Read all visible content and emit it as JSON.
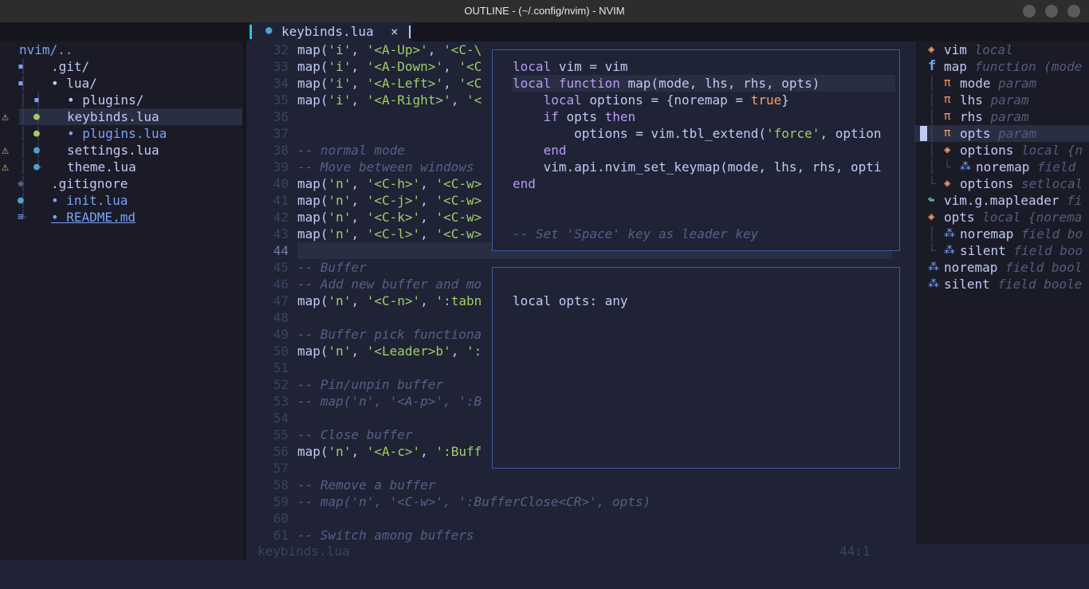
{
  "window": {
    "title": "OUTLINE - (~/.config/nvim) - NVIM"
  },
  "tab": {
    "icon": "lua-file-icon",
    "glyph": "●",
    "name": "keybinds.lua",
    "close": "×"
  },
  "tree": {
    "root": "nvim/..",
    "items": [
      {
        "text": ".git/",
        "icon": "▪",
        "warn": ""
      },
      {
        "text": "• lua/",
        "icon": "▪",
        "warn": ""
      },
      {
        "text": "• plugins/",
        "icon": "▪",
        "warn": ""
      },
      {
        "text": "keybinds.lua",
        "icon": "●",
        "warn": "⚠"
      },
      {
        "text": "• plugins.lua",
        "icon": "●",
        "warn": ""
      },
      {
        "text": "settings.lua",
        "icon": "●",
        "warn": "⚠"
      },
      {
        "text": "theme.lua",
        "icon": "●",
        "warn": "⚠"
      },
      {
        "text": ".gitignore",
        "icon": "◆",
        "warn": ""
      },
      {
        "text": "• init.lua",
        "icon": "●",
        "warn": ""
      },
      {
        "text": "• README.md",
        "icon": "≡",
        "warn": ""
      }
    ]
  },
  "editor": {
    "lines": [
      {
        "n": "32",
        "code": "map('i', '<A-Up>', '<C-\\"
      },
      {
        "n": "33",
        "code": "map('i', '<A-Down>', '<C"
      },
      {
        "n": "34",
        "code": "map('i', '<A-Left>', '<C"
      },
      {
        "n": "35",
        "code": "map('i', '<A-Right>', '<"
      },
      {
        "n": "36",
        "code": ""
      },
      {
        "n": "37",
        "code": ""
      },
      {
        "n": "38",
        "code": "-- normal mode"
      },
      {
        "n": "39",
        "code": "-- Move between windows"
      },
      {
        "n": "40",
        "code": "map('n', '<C-h>', '<C-w>"
      },
      {
        "n": "41",
        "code": "map('n', '<C-j>', '<C-w>"
      },
      {
        "n": "42",
        "code": "map('n', '<C-k>', '<C-w>"
      },
      {
        "n": "43",
        "code": "map('n', '<C-l>', '<C-w>"
      },
      {
        "n": "44",
        "code": ""
      },
      {
        "n": "45",
        "code": "-- Buffer"
      },
      {
        "n": "46",
        "code": "-- Add new buffer and mo"
      },
      {
        "n": "47",
        "code": "map('n', '<C-n>', ':tabn"
      },
      {
        "n": "48",
        "code": ""
      },
      {
        "n": "49",
        "code": "-- Buffer pick functiona"
      },
      {
        "n": "50",
        "code": "map('n', '<Leader>b', ':"
      },
      {
        "n": "51",
        "code": ""
      },
      {
        "n": "52",
        "code": "-- Pin/unpin buffer"
      },
      {
        "n": "53",
        "code": "-- map('n', '<A-p>', ':B"
      },
      {
        "n": "54",
        "code": ""
      },
      {
        "n": "55",
        "code": "-- Close buffer"
      },
      {
        "n": "56",
        "code": "map('n', '<A-c>', ':Buff"
      },
      {
        "n": "57",
        "code": ""
      },
      {
        "n": "58",
        "code": "-- Remove a buffer"
      },
      {
        "n": "59",
        "code": "-- map('n', '<C-w>', ':BufferClose<CR>', opts)"
      },
      {
        "n": "60",
        "code": ""
      },
      {
        "n": "61",
        "code": "-- Switch among buffers"
      }
    ]
  },
  "preview": {
    "lines": [
      "local vim = vim",
      "local function map(mode, lhs, rhs, opts)",
      "    local options = {noremap = true}",
      "    if opts then",
      "        options = vim.tbl_extend('force', option",
      "    end",
      "    vim.api.nvim_set_keymap(mode, lhs, rhs, opti",
      "end",
      "",
      "",
      "-- Set 'Space' key as leader key"
    ]
  },
  "hover": {
    "text": "local opts: any"
  },
  "outline": {
    "items": [
      {
        "guide": "",
        "icon": "◈",
        "name": "vim",
        "detail": "local"
      },
      {
        "guide": "",
        "icon": "f",
        "name": "map",
        "detail": "function (mode"
      },
      {
        "guide": "│",
        "icon": "π",
        "name": "mode",
        "detail": "param"
      },
      {
        "guide": "│",
        "icon": "π",
        "name": "lhs",
        "detail": "param"
      },
      {
        "guide": "│",
        "icon": "π",
        "name": "rhs",
        "detail": "param"
      },
      {
        "guide": "│",
        "icon": "π",
        "name": "opts",
        "detail": "param"
      },
      {
        "guide": "│",
        "icon": "◈",
        "name": "options",
        "detail": "local {n"
      },
      {
        "guide": "│ └",
        "icon": "⁂",
        "name": "noremap",
        "detail": "field"
      },
      {
        "guide": "└",
        "icon": "◈",
        "name": "options",
        "detail": "setlocal"
      },
      {
        "guide": "",
        "icon": "↬",
        "name": "vim.g.mapleader",
        "detail": "fi"
      },
      {
        "guide": "",
        "icon": "◈",
        "name": "opts",
        "detail": "local {norema"
      },
      {
        "guide": "│",
        "icon": "⁂",
        "name": "noremap",
        "detail": "field bo"
      },
      {
        "guide": "└",
        "icon": "⁂",
        "name": "silent",
        "detail": "field boo"
      },
      {
        "guide": "",
        "icon": "⁂",
        "name": "noremap",
        "detail": "field bool"
      },
      {
        "guide": "",
        "icon": "⁂",
        "name": "silent",
        "detail": "field boole"
      }
    ]
  },
  "status": {
    "file": "keybinds.lua",
    "position": "44:1"
  },
  "colors": {
    "accent": "#2ac3de",
    "border": "#3d59a1",
    "warning": "#e0af68",
    "string": "#9ece6a",
    "keyword": "#bb9af7",
    "comment": "#565f89"
  }
}
